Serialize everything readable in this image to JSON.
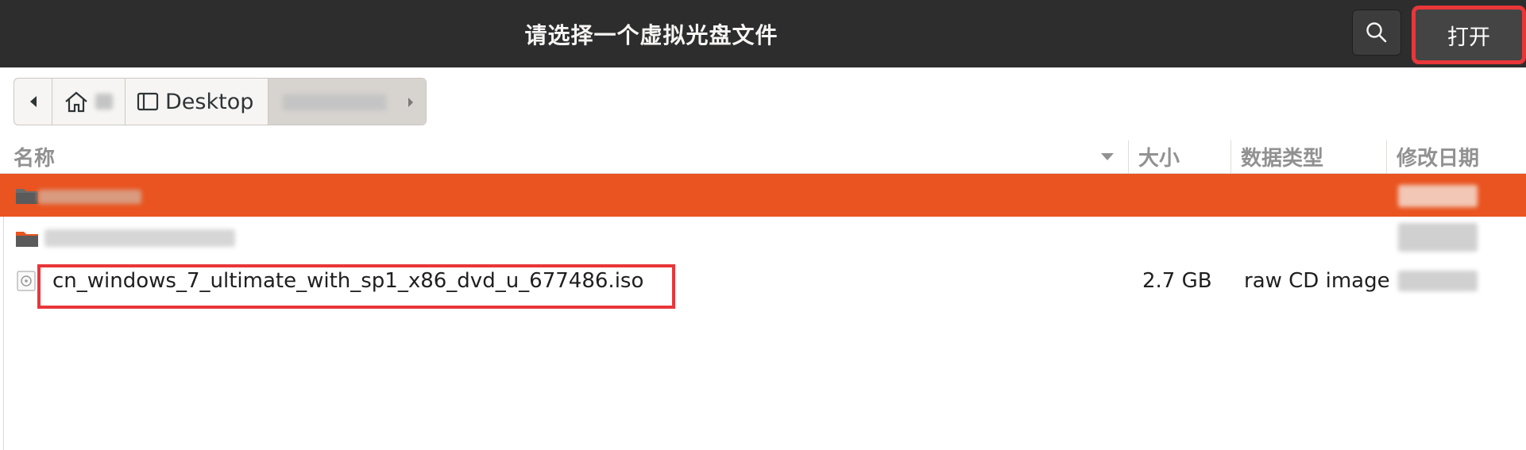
{
  "dialog": {
    "title": "请选择一个虚拟光盘文件",
    "search_icon": "search-icon",
    "open_label": "打开",
    "highlight_color": "#e8363a"
  },
  "pathbar": {
    "back_icon": "back-arrow-icon",
    "home_icon": "home-icon",
    "desktop_icon": "desktop-drive-icon",
    "desktop_label": "Desktop",
    "forward_icon": "forward-arrow-icon"
  },
  "columns": {
    "name": "名称",
    "size": "大小",
    "type": "数据类型",
    "modified": "修改日期"
  },
  "files": [
    {
      "icon": "folder-icon",
      "name": "",
      "size": "",
      "type": "",
      "selected": true
    },
    {
      "icon": "folder-icon",
      "name": "",
      "size": "",
      "type": "",
      "selected": false
    },
    {
      "icon": "disc-image-icon",
      "name": "cn_windows_7_ultimate_with_sp1_x86_dvd_u_677486.iso",
      "size": "2.7 GB",
      "type": "raw CD image",
      "selected": false
    }
  ],
  "accent_color": "#e95420"
}
